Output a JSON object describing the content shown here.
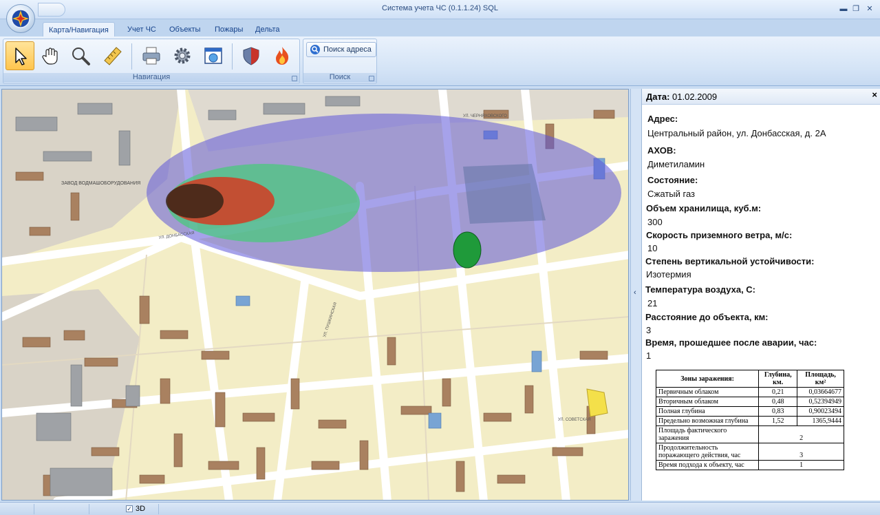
{
  "window": {
    "title": "Система учета ЧС (0.1.1.24) SQL"
  },
  "ribbon": {
    "tabs": [
      {
        "label": "Карта/Навигация",
        "active": true
      },
      {
        "label": "Учет ЧС"
      },
      {
        "label": "Объекты"
      },
      {
        "label": "Пожары"
      },
      {
        "label": "Дельта"
      }
    ],
    "groups": {
      "navigation": "Навигация",
      "search": "Поиск"
    },
    "address_search_label": "Поиск адреса"
  },
  "panel": {
    "date_label": "Дата:",
    "date_value": "01.02.2009",
    "fields": [
      {
        "label": "Адрес:",
        "value": "Центральный район, ул. Донбасская, д. 2А"
      },
      {
        "label": "АХОВ:",
        "value": "Диметиламин"
      },
      {
        "label": "Состояние:",
        "value": "Сжатый газ"
      },
      {
        "label": "Объем хранилища, куб.м:",
        "value": "300"
      },
      {
        "label": "Скорость приземного ветра,  м/с:",
        "value": "10"
      },
      {
        "label": "Степень вертикальной устойчивости:",
        "value": "Изотермия"
      },
      {
        "label": "Температура воздуха, С:",
        "value": "21"
      },
      {
        "label": "Расстояние до объекта, км:",
        "value": "3"
      },
      {
        "label": "Время, прошедшее после аварии, час:",
        "value": "1"
      }
    ],
    "zones_table": {
      "headers": [
        "Зоны заражения:",
        "Глубина, км.",
        "Площадь, км²"
      ],
      "rows": [
        [
          "Первичным облаком",
          "0,21",
          "0,03664677"
        ],
        [
          "Вторичным облаком",
          "0,48",
          "0,52394949"
        ],
        [
          "Полная глубина",
          "0,83",
          "0,90023494"
        ],
        [
          "Предельно возможная глубина",
          "1,52",
          "1365,9444"
        ]
      ],
      "merged_rows": [
        [
          "Площадь фактического заражения",
          "2"
        ],
        [
          "Продолжительность поражающего действия, час",
          "3"
        ],
        [
          "Время подхода к объекту, час",
          "1"
        ]
      ]
    }
  },
  "map": {
    "labels": {
      "plant": "ЗАВОД ВОДМАШОБОРУДОВАНИЯ",
      "street_donbass": "УЛ. ДОНБАССКАЯ",
      "street_chernyakh": "УЛ. ЧЕРНЯХОВСКОГО",
      "street_sovetskaya": "УЛ. СОВЕТСКАЯ",
      "street_pushkinskaya": "УЛ. ПУШКИНСКАЯ"
    },
    "colors": {
      "zone_primary": "#c0392b",
      "zone_secondary": "#2ecc71",
      "zone_full": "#6a5acd",
      "building": "#b08a6a",
      "road": "#ffffff",
      "ground": "#f4eec8"
    }
  },
  "statusbar": {
    "checkbox_3d_label": "3D",
    "checkbox_3d_mark": "✓"
  }
}
